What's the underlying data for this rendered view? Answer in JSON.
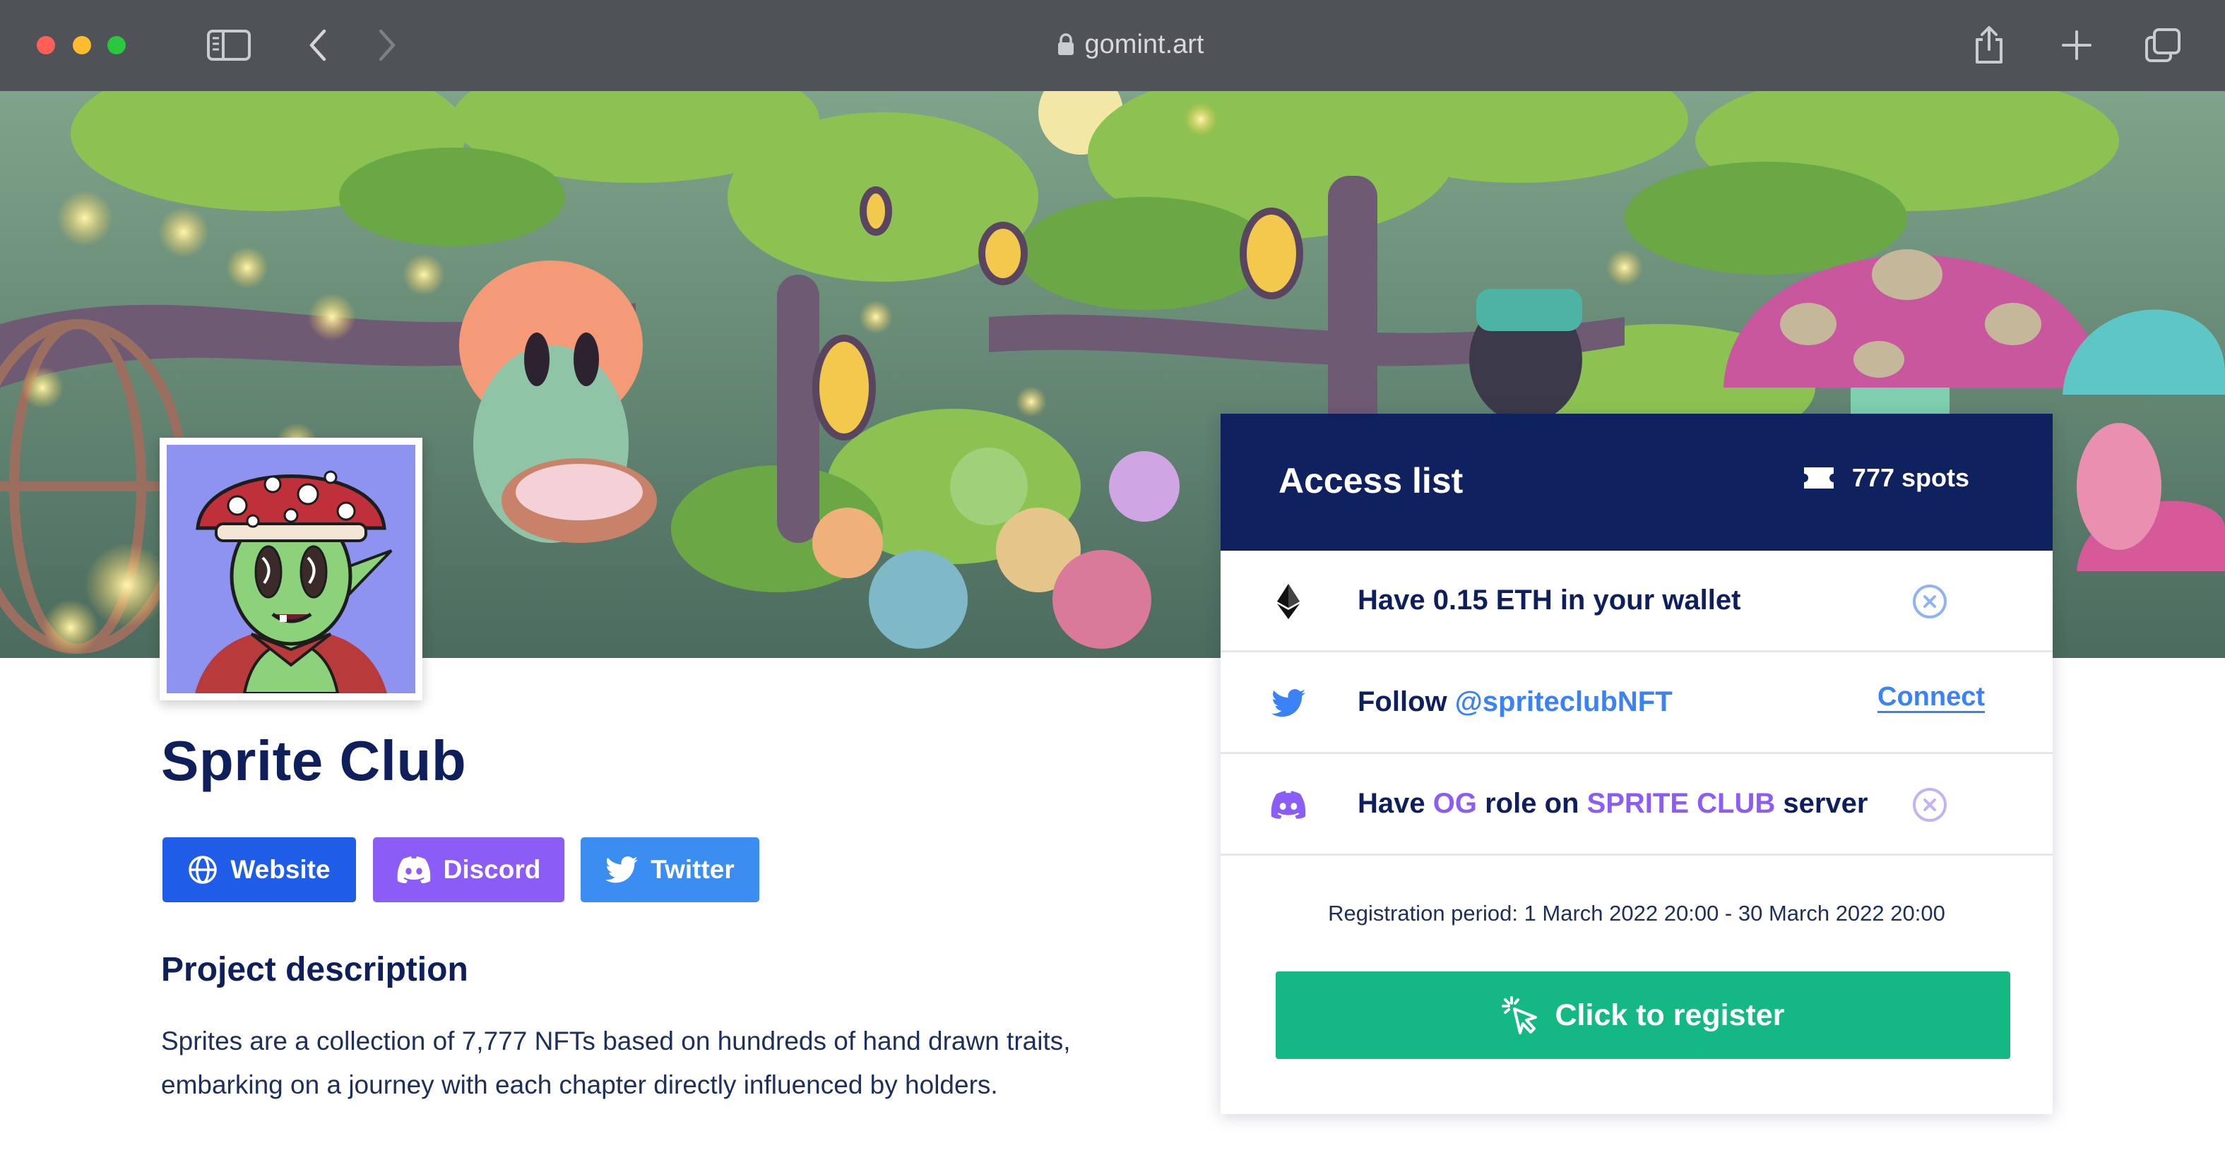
{
  "browser": {
    "url": "gomint.art",
    "icons": {
      "sidebar": "sidebar-icon",
      "back": "chevron-left-icon",
      "forward": "chevron-right-icon",
      "lock": "lock-icon",
      "share": "share-icon",
      "new_tab": "plus-icon",
      "tabs": "tabs-icon"
    }
  },
  "project": {
    "name": "Sprite Club",
    "links": [
      {
        "label": "Website",
        "icon": "globe-icon",
        "color": "#1f5ce8"
      },
      {
        "label": "Discord",
        "icon": "discord-icon",
        "color": "#8b5cf6"
      },
      {
        "label": "Twitter",
        "icon": "twitter-icon",
        "color": "#3b8df2"
      }
    ],
    "description_title": "Project description",
    "description": "Sprites are a collection of 7,777 NFTs based on hundreds of hand drawn traits, embarking on a journey with each chapter directly influenced by holders."
  },
  "access_list": {
    "title": "Access list",
    "spots": "777 spots",
    "requirements": [
      {
        "icon": "ethereum-icon",
        "text": "Have 0.15 ETH in your wallet",
        "status": "x-circle-icon"
      },
      {
        "icon": "twitter-icon",
        "prefix": "Follow ",
        "handle": "@spriteclubNFT",
        "action": "Connect"
      },
      {
        "icon": "discord-icon",
        "part1": "Have ",
        "role": "OG",
        "part2": " role on ",
        "server": "SPRITE CLUB",
        "part3": " server",
        "status": "x-circle-icon"
      }
    ],
    "period": "Registration period: 1 March 2022 20:00 - 30 March 2022 20:00",
    "register_label": "Click to register",
    "register_icon": "cursor-click-icon"
  },
  "colors": {
    "navy": "#10215f",
    "accent_green": "#14b884",
    "accent_blue": "#3b82f6",
    "accent_purple": "#8b5cf6"
  }
}
